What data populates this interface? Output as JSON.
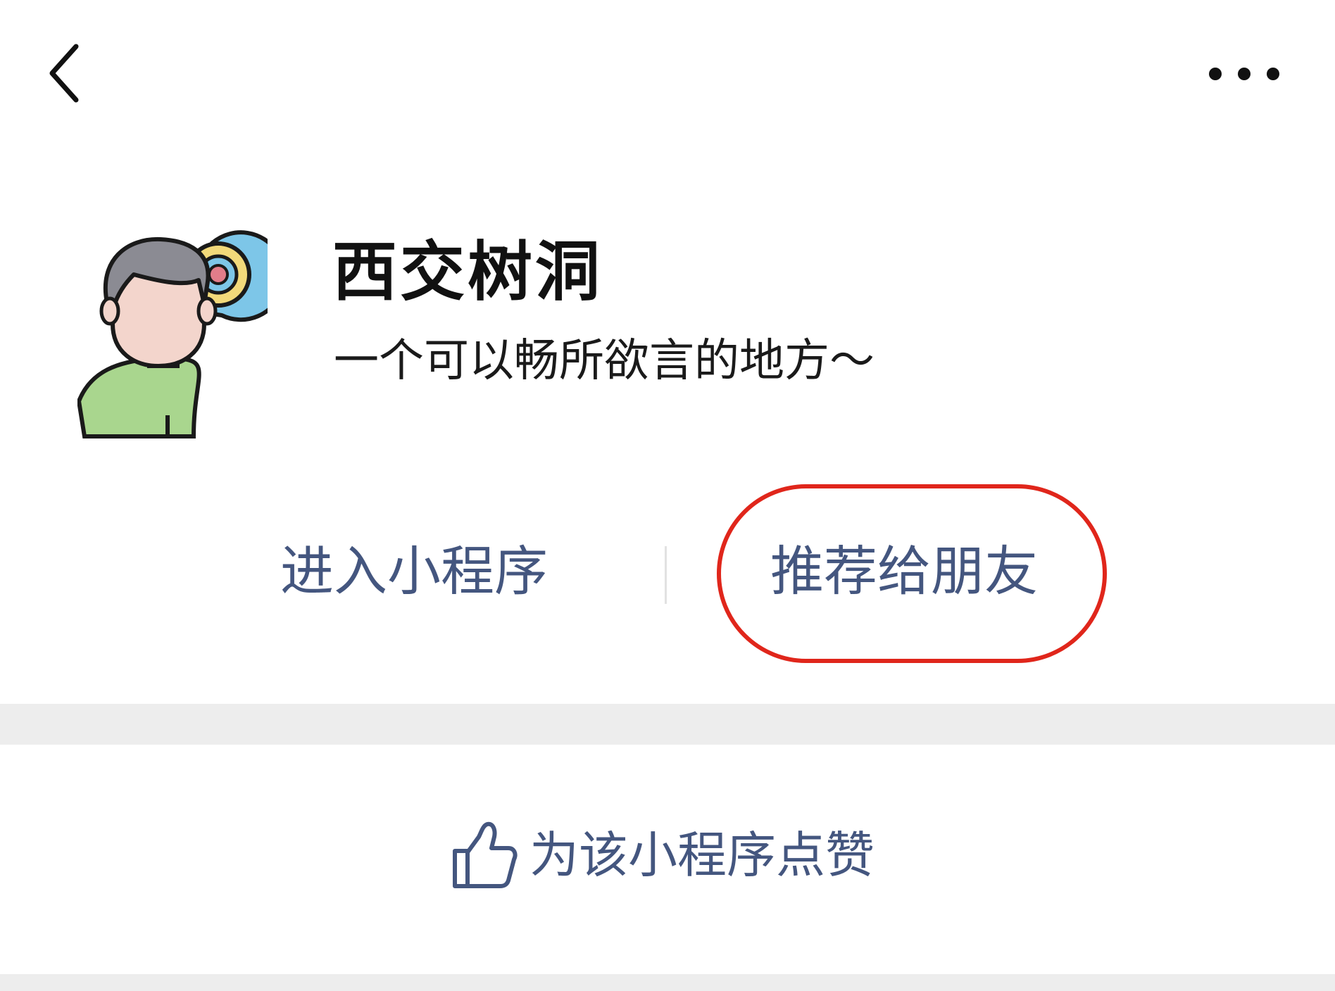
{
  "nav": {
    "back_icon": "chevron-left-icon",
    "more_icon": "more-dots-icon"
  },
  "profile": {
    "avatar_icon": "person-with-speech-bubble-icon",
    "name": "西交树洞",
    "description": "一个可以畅所欲言的地方～"
  },
  "actions": {
    "enter_label": "进入小程序",
    "recommend_label": "推荐给朋友"
  },
  "like": {
    "icon": "thumbs-up-icon",
    "label": "为该小程序点赞"
  },
  "colors": {
    "link": "#44567f",
    "highlight": "#e0261b",
    "separator": "#ededed"
  }
}
